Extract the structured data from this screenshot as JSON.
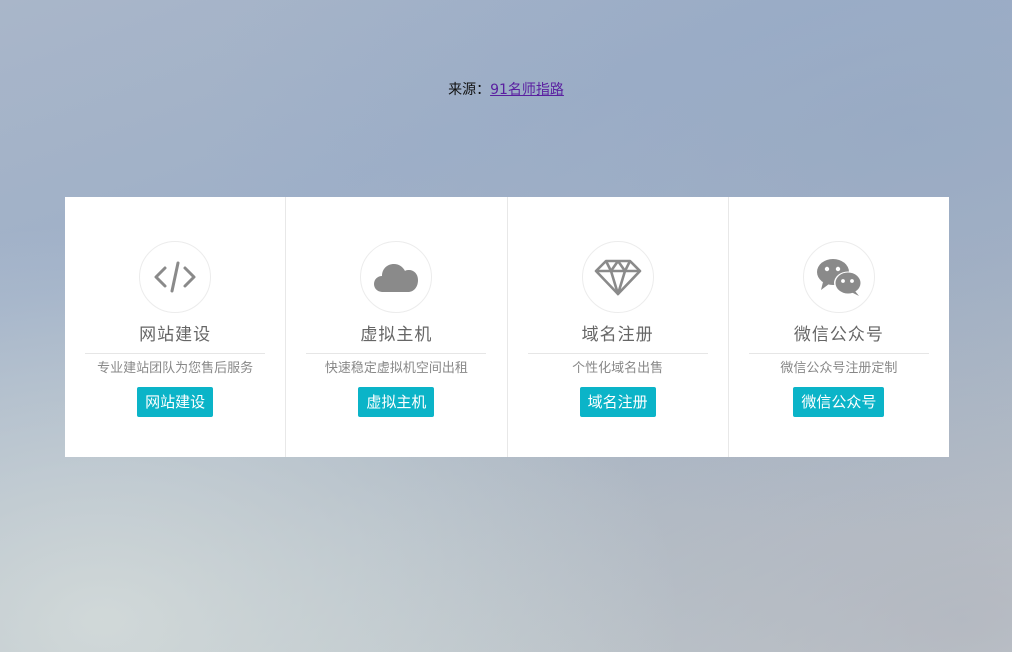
{
  "header": {
    "source_label": "来源：",
    "source_link": "91名师指路"
  },
  "cards": [
    {
      "icon": "code-icon",
      "title": "网站建设",
      "desc": "专业建站团队为您售后服务",
      "button": "网站建设"
    },
    {
      "icon": "cloud-icon",
      "title": "虚拟主机",
      "desc": "快速稳定虚拟机空间出租",
      "button": "虚拟主机"
    },
    {
      "icon": "diamond-icon",
      "title": "域名注册",
      "desc": "个性化域名出售",
      "button": "域名注册"
    },
    {
      "icon": "wechat-icon",
      "title": "微信公众号",
      "desc": "微信公众号注册定制",
      "button": "微信公众号"
    }
  ],
  "colors": {
    "accent": "#0bb4c8",
    "icon": "#8a8a8a",
    "link": "#5a1fa0"
  }
}
